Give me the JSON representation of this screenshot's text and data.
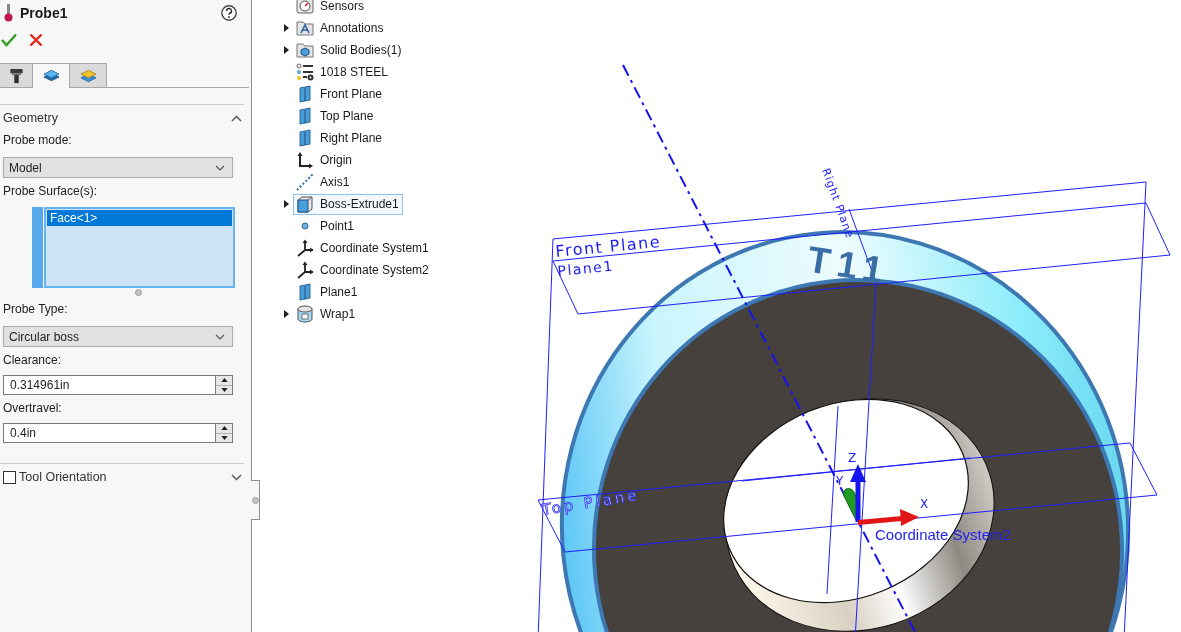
{
  "property_manager": {
    "title": "Probe1",
    "tabs": [
      {
        "selected": false
      },
      {
        "selected": true
      },
      {
        "selected": false
      }
    ],
    "sections": [
      {
        "kind": "group",
        "title": "Geometry",
        "expanded": true,
        "fields": [
          {
            "kind": "dropdown",
            "label": "Probe mode:",
            "value": "Model"
          },
          {
            "kind": "selection",
            "label": "Probe Surface(s):",
            "items": [
              {
                "text": "Face<1>",
                "selected": true
              }
            ]
          },
          {
            "kind": "dropdown",
            "label": "Probe Type:",
            "value": "Circular boss"
          },
          {
            "kind": "spinner",
            "label": "Clearance:",
            "value": "0.314961in"
          },
          {
            "kind": "spinner",
            "label": "Overtravel:",
            "value": "0.4in"
          }
        ]
      },
      {
        "kind": "optional_group",
        "title": "Tool Orientation",
        "expanded": false,
        "checked": false
      }
    ]
  },
  "feature_tree": {
    "items": [
      {
        "label": "Sensors",
        "kind": "sensors",
        "expandable": false,
        "selected": false
      },
      {
        "label": "Annotations",
        "kind": "annotations",
        "expandable": true,
        "selected": false
      },
      {
        "label": "Solid Bodies(1)",
        "kind": "bodies",
        "expandable": true,
        "selected": false
      },
      {
        "label": "1018 STEEL",
        "kind": "material",
        "expandable": false,
        "selected": false
      },
      {
        "label": "Front Plane",
        "kind": "plane",
        "expandable": false,
        "selected": false
      },
      {
        "label": "Top Plane",
        "kind": "plane",
        "expandable": false,
        "selected": false
      },
      {
        "label": "Right Plane",
        "kind": "plane",
        "expandable": false,
        "selected": false
      },
      {
        "label": "Origin",
        "kind": "origin",
        "expandable": false,
        "selected": false
      },
      {
        "label": "Axis1",
        "kind": "axis",
        "expandable": false,
        "selected": false
      },
      {
        "label": "Boss-Extrude1",
        "kind": "feature",
        "expandable": true,
        "selected": true
      },
      {
        "label": "Point1",
        "kind": "point",
        "expandable": false,
        "selected": false
      },
      {
        "label": "Coordinate System1",
        "kind": "coordsys",
        "expandable": false,
        "selected": false
      },
      {
        "label": "Coordinate System2",
        "kind": "coordsys",
        "expandable": false,
        "selected": false
      },
      {
        "label": "Plane1",
        "kind": "plane",
        "expandable": false,
        "selected": false
      },
      {
        "label": "Wrap1",
        "kind": "wrap",
        "expandable": true,
        "selected": false
      }
    ]
  },
  "viewport": {
    "plane_labels": [
      "Front Plane",
      "Plane1",
      "Top Plane",
      "Right Plane"
    ],
    "engraving": "T11",
    "coordinate_system": {
      "name": "Coordinate System2",
      "axes": [
        "X",
        "Y",
        "Z"
      ]
    }
  }
}
